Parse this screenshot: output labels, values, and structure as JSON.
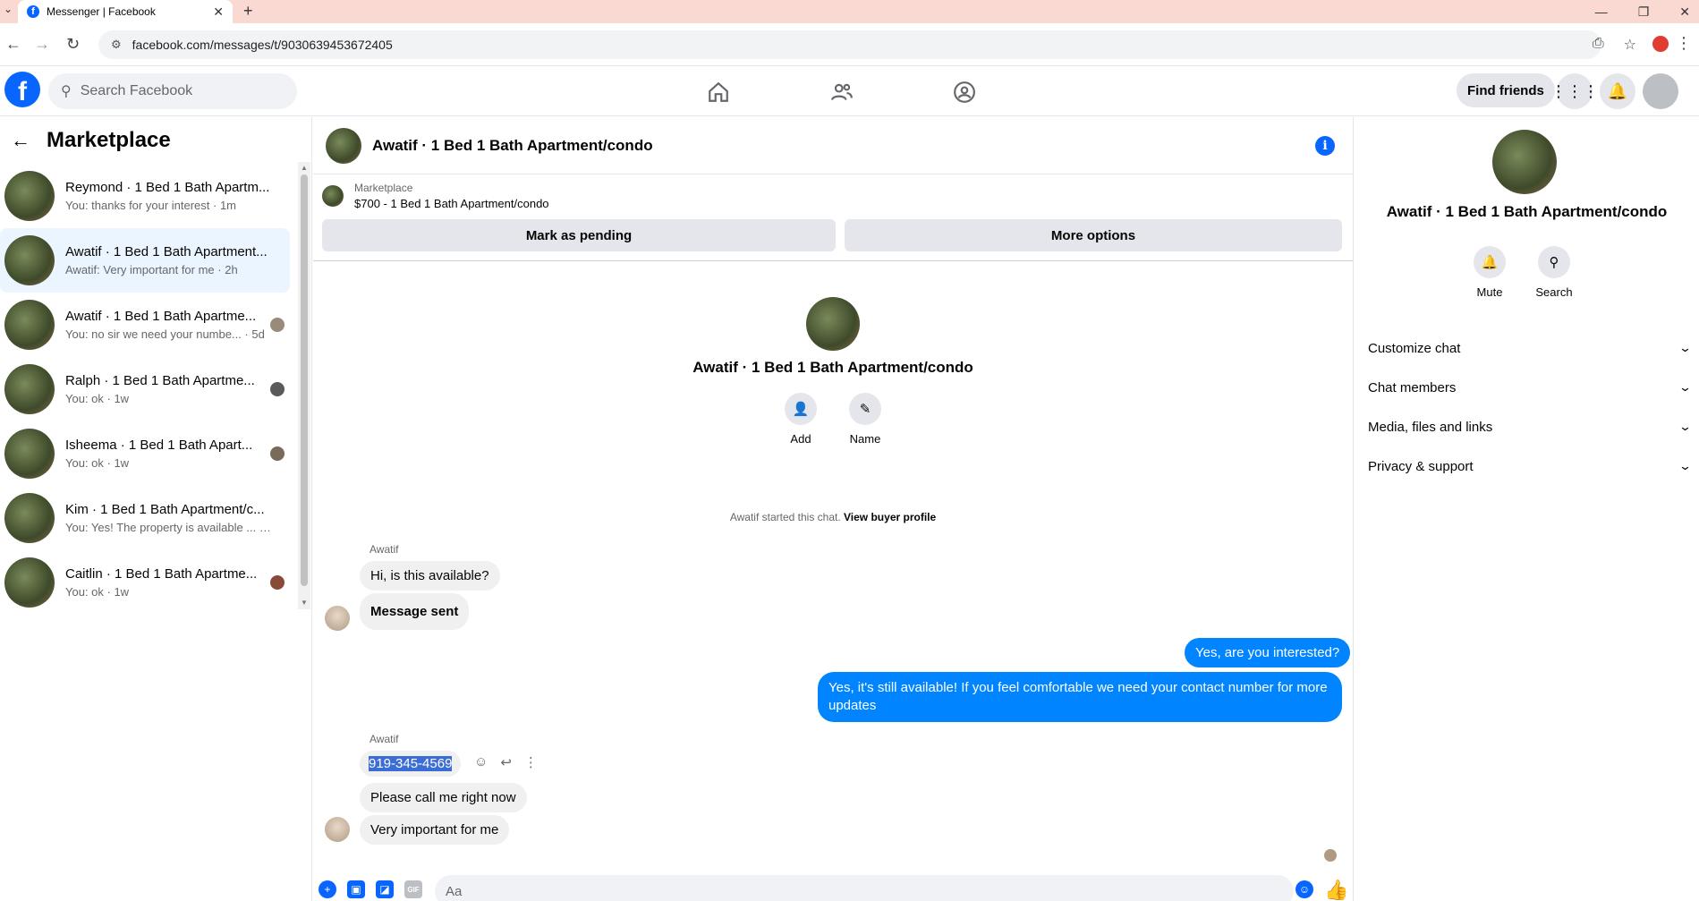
{
  "browser": {
    "tab_title": "Messenger | Facebook",
    "url": "facebook.com/messages/t/9030639453672405"
  },
  "header": {
    "search_placeholder": "Search Facebook",
    "find_friends": "Find friends"
  },
  "sidebar": {
    "title": "Marketplace",
    "conversations": [
      {
        "name": "Reymond · 1 Bed 1 Bath Apartm...",
        "snippet": "You: thanks for your interest · 1m"
      },
      {
        "name": "Awatif · 1 Bed 1 Bath Apartment...",
        "snippet": "Awatif: Very important for me · 2h"
      },
      {
        "name": "Awatif · 1 Bed 1 Bath Apartme...",
        "snippet": "You: no sir we need your numbe... · 5d"
      },
      {
        "name": "Ralph · 1 Bed 1 Bath Apartme...",
        "snippet": "You: ok · 1w"
      },
      {
        "name": "Isheema · 1 Bed 1 Bath Apart...",
        "snippet": "You: ok · 1w"
      },
      {
        "name": "Kim · 1 Bed 1 Bath Apartment/c...",
        "snippet": "You: Yes! The property is available ... · 1w"
      },
      {
        "name": "Caitlin · 1 Bed 1 Bath Apartme...",
        "snippet": "You: ok · 1w"
      }
    ]
  },
  "chat": {
    "title": "Awatif · 1 Bed 1 Bath Apartment/condo",
    "marketplace_label": "Marketplace",
    "listing": "$700 - 1 Bed 1 Bath Apartment/condo",
    "mark_pending": "Mark as pending",
    "more_options": "More options",
    "intro_name": "Awatif · 1 Bed 1 Bath Apartment/condo",
    "add_label": "Add",
    "name_label": "Name",
    "started_text": "Awatif started this chat.",
    "view_profile": "View buyer profile",
    "sender": "Awatif",
    "msg1": "Hi, is this available?",
    "msg2": "Message sent",
    "msg3": "Yes, are you interested?",
    "msg4": "Yes, it's still available! If you feel comfortable  we need your contact number for more updates",
    "msg5": "919-345-4569",
    "msg6": "Please call me right now",
    "msg7": "Very important for me",
    "composer_placeholder": "Aa"
  },
  "details": {
    "name": "Awatif · 1 Bed 1 Bath Apartment/condo",
    "mute": "Mute",
    "search": "Search",
    "sections": [
      "Customize chat",
      "Chat members",
      "Media, files and links",
      "Privacy & support"
    ]
  },
  "colors": {
    "accent": "#0866ff",
    "outgoing_bubble": "#0084ff",
    "incoming_bubble": "#f0f0f0"
  }
}
